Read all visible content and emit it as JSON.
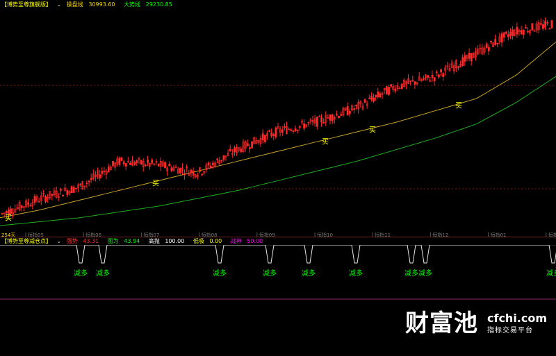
{
  "main_header": {
    "title": "【博势至尊旗舰版】",
    "items": [
      {
        "label": "操盘线",
        "value": "30993.60",
        "color": "#ffd700"
      },
      {
        "label": "大势线",
        "value": "29230.85",
        "color": "#00ff00"
      }
    ]
  },
  "lower_header": {
    "title": "【博势至尊减仓点】",
    "items": [
      {
        "label": "强势",
        "value": "43.31",
        "color": "#ff3333"
      },
      {
        "label": "图为",
        "value": "43.94",
        "color": "#00ff00"
      },
      {
        "label": "高抛",
        "value": "100.00",
        "color": "#ffffff"
      },
      {
        "label": "低吸",
        "value": "0.00",
        "color": "#ffff00"
      },
      {
        "label": "战神",
        "value": "50.00",
        "color": "#ff00ff"
      }
    ]
  },
  "axis": {
    "corner_label": "254天",
    "month_labels": [
      "恒指05",
      "恒指06",
      "恒指07",
      "恒指08",
      "恒指09",
      "恒指10",
      "恒指11",
      "恒指12",
      "恒指01",
      "恒指0"
    ]
  },
  "signals": {
    "buy_label": "买",
    "reduce_label": "减多"
  },
  "logo": {
    "brand": "财富池",
    "site": "cfchi.com",
    "slogan": "指标交易平台"
  },
  "colors": {
    "up_candle": "#ff2a2a",
    "ma_short": "#c9a227",
    "ma_long": "#1fae1f",
    "signal_text": "#00ff00",
    "buy_text": "#ffff00",
    "grid_dash": "#8b1a1a"
  },
  "chart_data": [
    {
      "type": "candlestick",
      "title": "",
      "x": [
        "恒指05",
        "恒指06",
        "恒指07",
        "恒指08",
        "恒指09",
        "恒指10",
        "恒指11",
        "恒指12",
        "恒指01"
      ],
      "candle_count": 254,
      "close_trend": [
        22200,
        23000,
        23600,
        24900,
        24700,
        24300,
        25500,
        26400,
        26900,
        27600,
        28700,
        29200,
        30300,
        31500,
        31900
      ],
      "series": [
        {
          "name": "操盘线",
          "last_value": 30993.6,
          "values": [
            22000,
            22400,
            22900,
            23400,
            23900,
            24400,
            24900,
            25400,
            25900,
            26400,
            26900,
            27500,
            28100,
            29300,
            30993.6
          ]
        },
        {
          "name": "大势线",
          "last_value": 29230.85,
          "values": [
            21600,
            21800,
            22000,
            22300,
            22600,
            23000,
            23400,
            23900,
            24400,
            24900,
            25500,
            26100,
            26800,
            27900,
            29230.85
          ]
        }
      ],
      "buy_signal_positions": [
        0.015,
        0.28,
        0.585,
        0.67,
        0.825
      ]
    },
    {
      "type": "line",
      "title": "",
      "signal_positions": [
        0.145,
        0.185,
        0.395,
        0.485,
        0.555,
        0.64,
        0.74,
        0.765,
        0.995
      ]
    }
  ]
}
